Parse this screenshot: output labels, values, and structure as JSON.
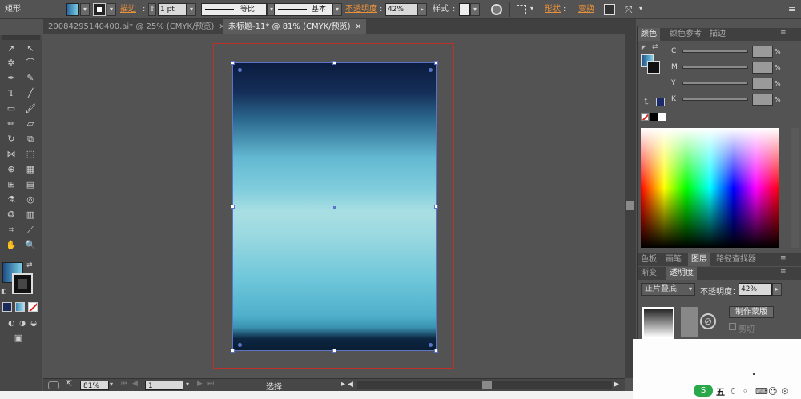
{
  "control_bar": {
    "object_type": "矩形",
    "stroke_label": "描边",
    "stroke_weight": "1 pt",
    "profile_label": "等比",
    "brush_label": "基本",
    "opacity_label": "不透明度",
    "opacity_value": "42%",
    "style_label": "样式",
    "shape_label": "形状",
    "transform_label": "变换"
  },
  "tabs": [
    {
      "label": "20084295140400.ai* @ 25% (CMYK/预览)",
      "close": "✕"
    },
    {
      "label": "未标题-11* @ 81% (CMYK/预览)",
      "close": "✕"
    }
  ],
  "status_bar": {
    "zoom": "81%",
    "artboard_number": "1",
    "tool_name": "选择"
  },
  "color_panel": {
    "tabs": [
      "颜色",
      "颜色参考",
      "描边"
    ],
    "channels": [
      {
        "label": "C",
        "unit": "%"
      },
      {
        "label": "M",
        "unit": "%"
      },
      {
        "label": "Y",
        "unit": "%"
      },
      {
        "label": "K",
        "unit": "%"
      }
    ]
  },
  "layers_panel": {
    "tabs": [
      "色板",
      "画笔",
      "图层",
      "路径查找器"
    ]
  },
  "transparency_panel": {
    "tabs": [
      "渐变",
      "透明度"
    ],
    "blend_mode": "正片叠底",
    "opacity_label": "不透明度：",
    "opacity_value": "42%",
    "make_mask_label": "制作蒙版",
    "clip_label": "剪切"
  },
  "taskbar": {
    "ime_label": "五"
  },
  "colors": {
    "artboard_border": "#c0302b",
    "selection": "#5b74c8",
    "accent_orange": "#e8903a"
  }
}
